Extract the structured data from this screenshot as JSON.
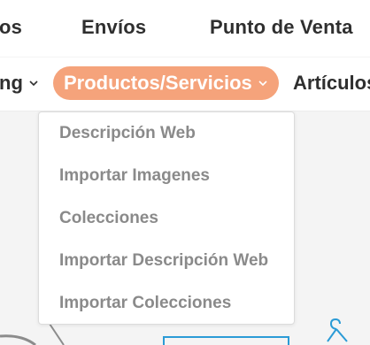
{
  "topnav": {
    "items": [
      {
        "label": "os"
      },
      {
        "label": "Envíos"
      },
      {
        "label": "Punto de Venta"
      }
    ]
  },
  "subnav": {
    "items": [
      {
        "label": "ng"
      },
      {
        "label": "Productos/Servicios"
      },
      {
        "label": "Artículos"
      }
    ],
    "active_color": "#f5a37b"
  },
  "dropdown": {
    "items": [
      {
        "label": "Descripción Web"
      },
      {
        "label": "Importar Imagenes"
      },
      {
        "label": "Colecciones"
      },
      {
        "label": "Importar Descripción Web"
      },
      {
        "label": "Importar Colecciones"
      }
    ]
  },
  "icons": {
    "chevron": "chevron-down-icon",
    "hanger": "hanger-icon"
  }
}
